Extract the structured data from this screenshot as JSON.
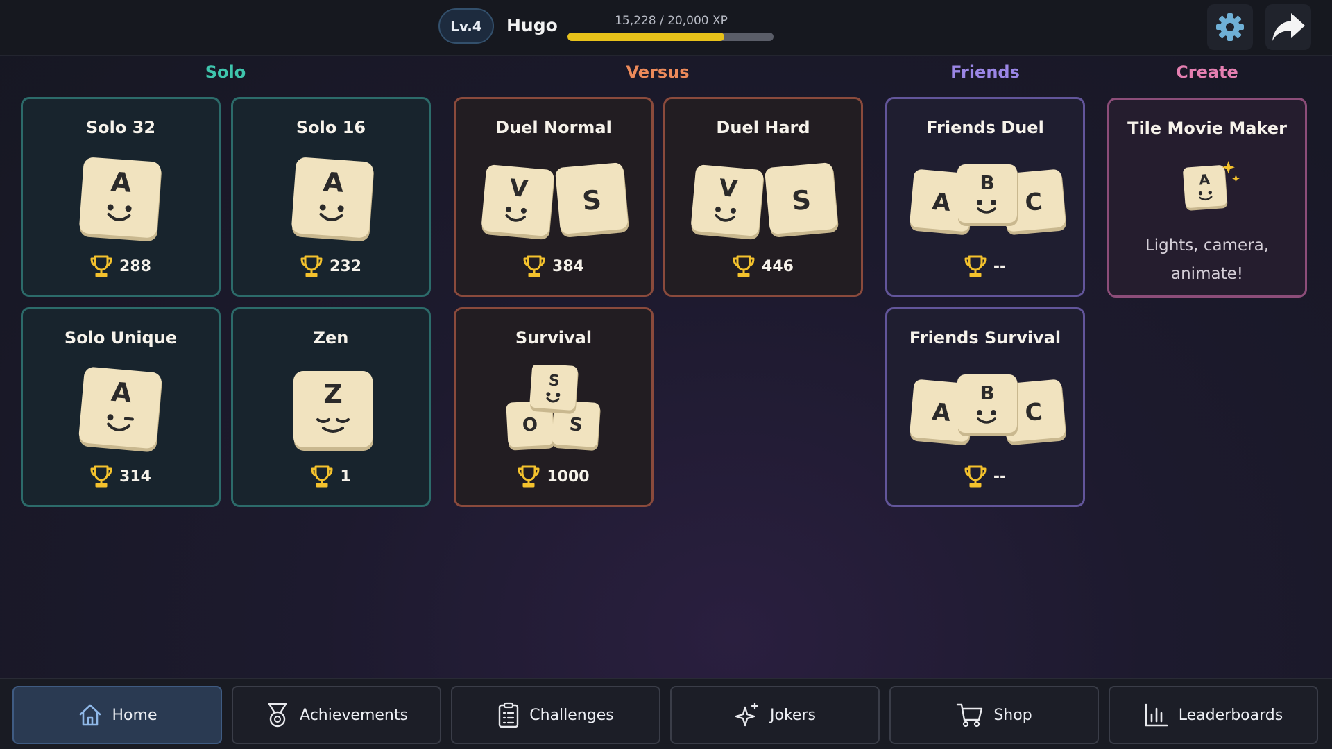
{
  "header": {
    "level": "Lv.4",
    "player_name": "Hugo",
    "xp_text": "15,228 / 20,000 XP",
    "xp_progress": 0.76,
    "settings_icon": "gear-icon",
    "share_icon": "share-arrow-icon"
  },
  "sections": {
    "solo": "Solo",
    "versus": "Versus",
    "friends": "Friends",
    "create": "Create"
  },
  "colors": {
    "solo": "#3fc5ad",
    "versus": "#ec8a5a",
    "friends": "#9b86e6",
    "create": "#e57fb1",
    "tile": "#f1e3bf",
    "trophy": "#f4c22d"
  },
  "cards": {
    "solo32": {
      "title": "Solo 32",
      "score": "288",
      "tiles": [
        "A"
      ]
    },
    "solo16": {
      "title": "Solo 16",
      "score": "232",
      "tiles": [
        "A"
      ]
    },
    "solo_unique": {
      "title": "Solo Unique",
      "score": "314",
      "tiles": [
        "A"
      ]
    },
    "zen": {
      "title": "Zen",
      "score": "1",
      "tiles": [
        "Z"
      ]
    },
    "duel_normal": {
      "title": "Duel Normal",
      "score": "384",
      "tiles": [
        "V",
        "S"
      ]
    },
    "duel_hard": {
      "title": "Duel Hard",
      "score": "446",
      "tiles": [
        "V",
        "S"
      ]
    },
    "survival": {
      "title": "Survival",
      "score": "1000",
      "tiles": [
        "S",
        "O",
        "S"
      ]
    },
    "friends_duel": {
      "title": "Friends Duel",
      "score": "--",
      "tiles": [
        "A",
        "B",
        "C"
      ]
    },
    "friends_survival": {
      "title": "Friends Survival",
      "score": "--",
      "tiles": [
        "A",
        "B",
        "C"
      ]
    },
    "tile_movie_maker": {
      "title": "Tile Movie Maker",
      "description_line1": "Lights, camera,",
      "description_line2": "animate!",
      "tiles": [
        "A"
      ]
    }
  },
  "nav": {
    "home": "Home",
    "achievements": "Achievements",
    "challenges": "Challenges",
    "jokers": "Jokers",
    "shop": "Shop",
    "leaderboards": "Leaderboards",
    "active": "home"
  }
}
